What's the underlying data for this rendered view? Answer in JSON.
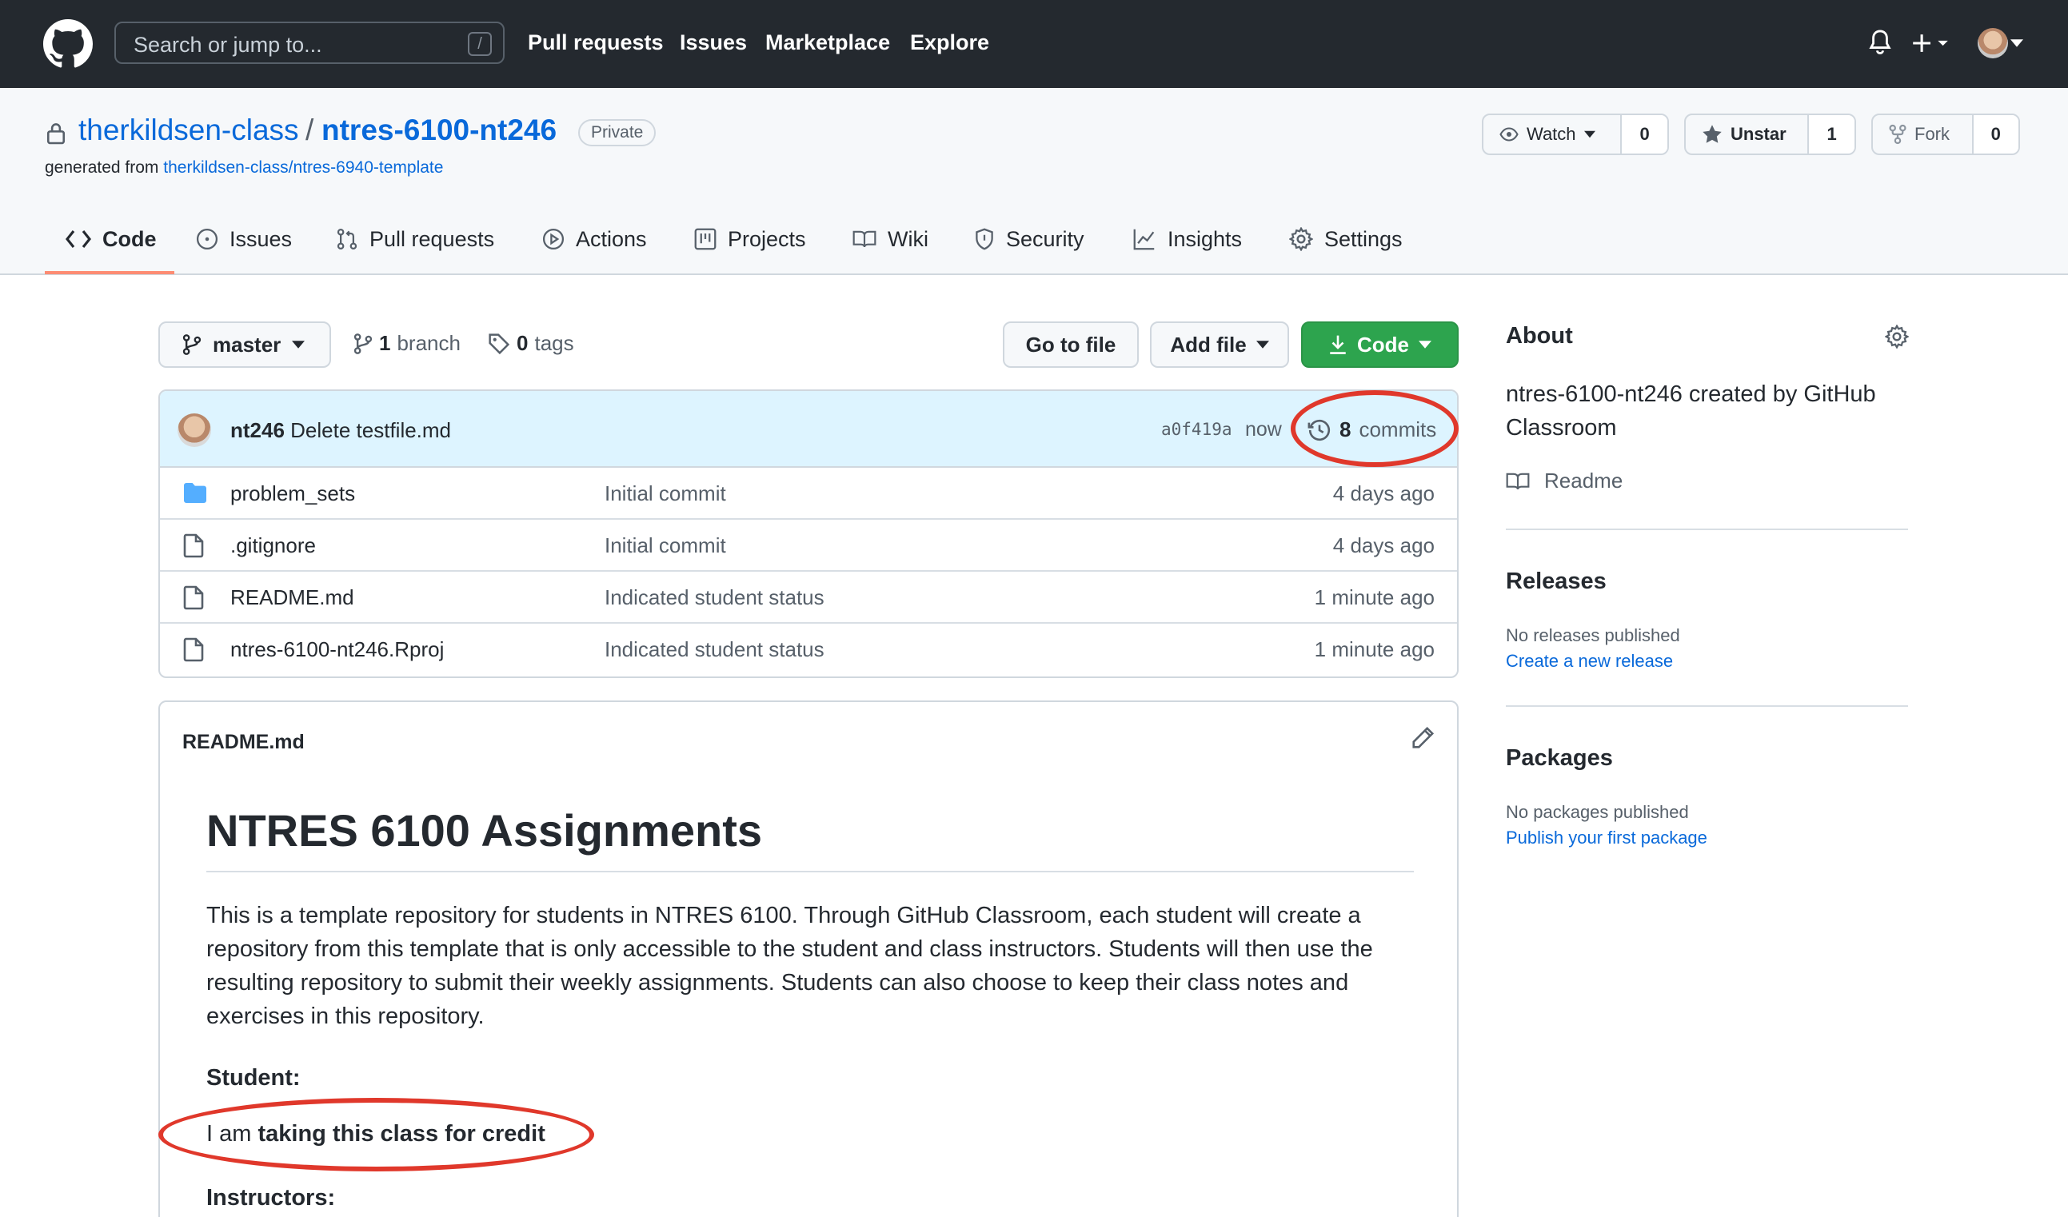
{
  "header": {
    "search_placeholder": "Search or jump to...",
    "search_shortcut": "/",
    "nav": [
      "Pull requests",
      "Issues",
      "Marketplace",
      "Explore"
    ]
  },
  "repo": {
    "owner": "therkildsen-class",
    "separator": "/",
    "name": "ntres-6100-nt246",
    "visibility": "Private",
    "generated_prefix": "generated from",
    "template": "therkildsen-class/ntres-6940-template",
    "watch_label": "Watch",
    "watch_count": "0",
    "star_label": "Unstar",
    "star_count": "1",
    "fork_label": "Fork",
    "fork_count": "0"
  },
  "tabs": [
    "Code",
    "Issues",
    "Pull requests",
    "Actions",
    "Projects",
    "Wiki",
    "Security",
    "Insights",
    "Settings"
  ],
  "filenav": {
    "branch": "master",
    "branch_count": "1",
    "branch_word": "branch",
    "tag_count": "0",
    "tag_word": "tags",
    "go_to_file": "Go to file",
    "add_file": "Add file",
    "code": "Code"
  },
  "commit": {
    "author": "nt246",
    "message": "Delete testfile.md",
    "sha": "a0f419a",
    "time": "now",
    "count": "8",
    "count_word": "commits"
  },
  "files": [
    {
      "name": "problem_sets",
      "type": "folder",
      "message": "Initial commit",
      "age": "4 days ago"
    },
    {
      "name": ".gitignore",
      "type": "file",
      "message": "Initial commit",
      "age": "4 days ago"
    },
    {
      "name": "README.md",
      "type": "file",
      "message": "Indicated student status",
      "age": "1 minute ago"
    },
    {
      "name": "ntres-6100-nt246.Rproj",
      "type": "file",
      "message": "Indicated student status",
      "age": "1 minute ago"
    }
  ],
  "readme": {
    "filename": "README.md",
    "h1": "NTRES 6100 Assignments",
    "paragraph": "This is a template repository for students in NTRES 6100. Through GitHub Classroom, each student will create a repository from this template that is only accessible to the student and class instructors. Students will then use the resulting repository to submit their weekly assignments. Students can also choose to keep their class notes and exercises in this repository.",
    "student_heading": "Student:",
    "student_prefix": "I am ",
    "student_bold": "taking this class for credit",
    "instructors_heading": "Instructors:"
  },
  "sidebar": {
    "about_heading": "About",
    "about_text": "ntres-6100-nt246 created by GitHub Classroom",
    "readme_link": "Readme",
    "releases_heading": "Releases",
    "releases_none": "No releases published",
    "releases_link": "Create a new release",
    "packages_heading": "Packages",
    "packages_none": "No packages published",
    "packages_link": "Publish your first package"
  },
  "colors": {
    "annotation": "#e0382b",
    "link": "#0969da",
    "green": "#2da44e"
  }
}
